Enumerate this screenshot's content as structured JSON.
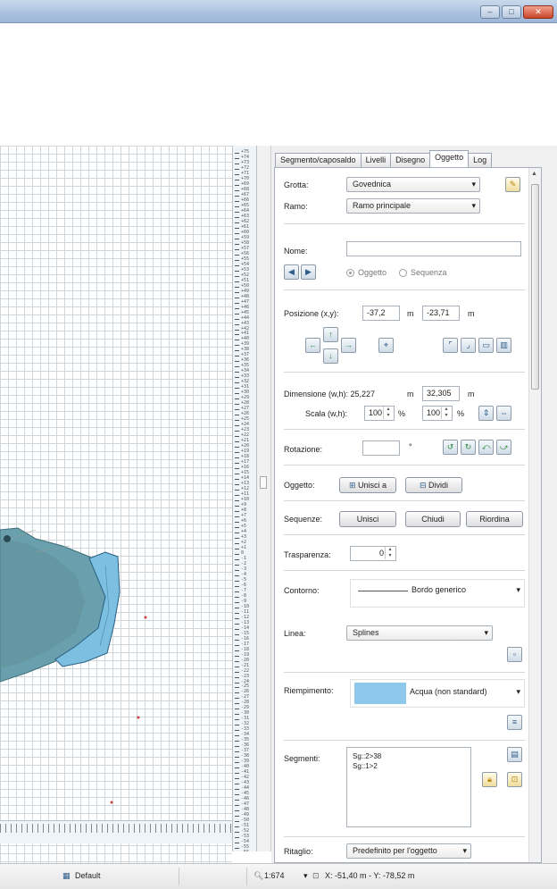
{
  "window": {
    "buttons": [
      "–",
      "□",
      "✕"
    ]
  },
  "ruler": {
    "vertical_labels": [
      "+75",
      "+74",
      "+73",
      "+72",
      "+71",
      "+70",
      "+69",
      "+68",
      "+67",
      "+66",
      "+65",
      "+64",
      "+63",
      "+62",
      "+61",
      "+60",
      "+59",
      "+58",
      "+57",
      "+56",
      "+55",
      "+54",
      "+53",
      "+52",
      "+51",
      "+50",
      "+49",
      "+48",
      "+47",
      "+46",
      "+45",
      "+44",
      "+43",
      "+42",
      "+41",
      "+40",
      "+39",
      "+38",
      "+37",
      "+36",
      "+35",
      "+34",
      "+33",
      "+32",
      "+31",
      "+30",
      "+29",
      "+28",
      "+27",
      "+26",
      "+25",
      "+24",
      "+23",
      "+22",
      "+21",
      "+20",
      "+19",
      "+18",
      "+17",
      "+16",
      "+15",
      "+14",
      "+13",
      "+12",
      "+11",
      "+10",
      "+9",
      "+8",
      "+7",
      "+6",
      "+5",
      "+4",
      "+3",
      "+2",
      "+1",
      "0",
      "-1",
      "-2",
      "-3",
      "-4",
      "-5",
      "-6",
      "-7",
      "-8",
      "-9",
      "-10",
      "-11",
      "-12",
      "-13",
      "-14",
      "-15",
      "-16",
      "-17",
      "-18",
      "-19",
      "-20",
      "-21",
      "-22",
      "-23",
      "-24",
      "-25",
      "-26",
      "-27",
      "-28",
      "-29",
      "-30",
      "-31",
      "-32",
      "-33",
      "-34",
      "-35",
      "-36",
      "-37",
      "-38",
      "-39",
      "-40",
      "-41",
      "-42",
      "-43",
      "-44",
      "-45",
      "-46",
      "-47",
      "-48",
      "-49",
      "-50",
      "-51",
      "-52",
      "-53",
      "-54",
      "-55",
      "-56"
    ]
  },
  "tabs": [
    {
      "label": "Segmento/caposaldo"
    },
    {
      "label": "Livelli"
    },
    {
      "label": "Disegno"
    },
    {
      "label": "Oggetto",
      "active": true
    },
    {
      "label": "Log"
    }
  ],
  "panel": {
    "grotta_label": "Grotta:",
    "grotta_value": "Govednica",
    "ramo_label": "Ramo:",
    "ramo_value": "Ramo principale",
    "nome_label": "Nome:",
    "nome_value": "",
    "radio_oggetto": "Oggetto",
    "radio_sequenza": "Sequenza",
    "posizione_label": "Posizione (x,y):",
    "pos_x": "-37,2",
    "pos_y": "-23,71",
    "unit_m": "m",
    "dimensione_label": "Dimensione (w,h): 25,227",
    "dim_h": "32,305",
    "scala_label": "Scala (w,h):",
    "scala_w": "100",
    "scala_h": "100",
    "unit_pct": "%",
    "rotazione_label": "Rotazione:",
    "rotazione_value": "",
    "unit_deg": "°",
    "oggetto_label": "Oggetto:",
    "unisci_a": "Unisci a",
    "dividi": "Dividi",
    "sequenze_label": "Sequenze:",
    "unisci": "Unisci",
    "chiudi": "Chiudi",
    "riordina": "Riordina",
    "trasparenza_label": "Trasparenza:",
    "trasparenza_value": "0",
    "contorno_label": "Contorno:",
    "contorno_value": "Bordo generico",
    "linea_label": "Linea:",
    "linea_value": "Splines",
    "riempimento_label": "Riempimento:",
    "riempimento_value": "Acqua (non standard)",
    "riempimento_color": "#8ec9ec",
    "segmenti_label": "Segmenti:",
    "segmenti_items": [
      "Sg::2>38",
      "Sg::1>2"
    ],
    "ritaglio_label": "Ritaglio:",
    "ritaglio_value": "Predefinito per l'oggetto"
  },
  "statusbar": {
    "profile": "Default",
    "scale": "1:674",
    "coords": "X: -51,40 m - Y: -78,52 m"
  },
  "colors": {
    "cave_fill": "#6aa0ad",
    "water_fill": "#7cbfe0",
    "accent": "#2f5d8a"
  }
}
